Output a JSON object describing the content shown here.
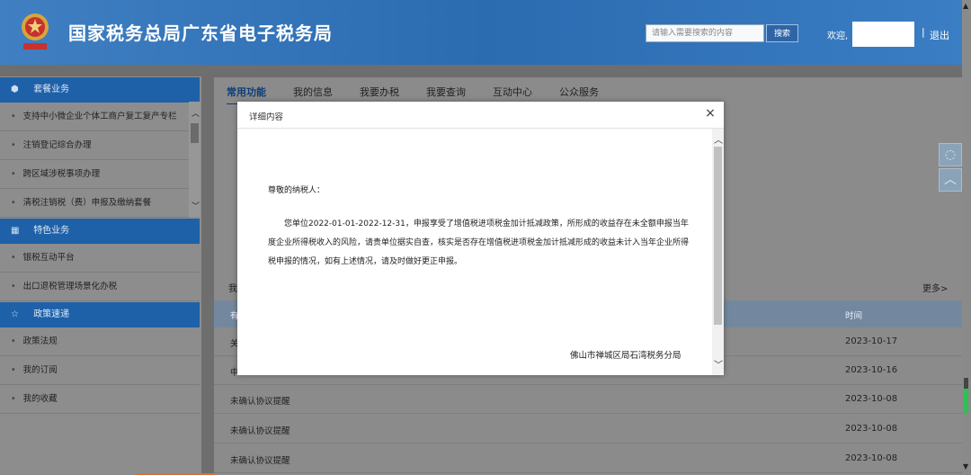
{
  "header": {
    "site_title": "国家税务总局广东省电子税务局",
    "search_placeholder": "请输入需要搜索的内容",
    "search_button": "搜索",
    "welcome": "欢迎,",
    "divider": "|",
    "logout": "退出"
  },
  "sidebar": {
    "sections": [
      {
        "title": "套餐业务",
        "icon": "cube-icon"
      },
      {
        "title": "特色业务",
        "icon": "grid-icon"
      },
      {
        "title": "政策速递",
        "icon": "star-icon"
      }
    ],
    "package_items": [
      "支持中小微企业个体工商户复工复产专栏",
      "注销登记综合办理",
      "跨区域涉税事项办理",
      "清税注销税（费）申报及缴纳套餐"
    ],
    "feature_items": [
      "银税互动平台",
      "出口退税管理场景化办税"
    ],
    "policy_items": [
      "政策法规",
      "我的订阅",
      "我的收藏"
    ]
  },
  "tabs": [
    {
      "label": "常用功能",
      "active": true
    },
    {
      "label": "我的信息",
      "active": false
    },
    {
      "label": "我要办税",
      "active": false
    },
    {
      "label": "我要查询",
      "active": false
    },
    {
      "label": "互动中心",
      "active": false
    },
    {
      "label": "公众服务",
      "active": false
    }
  ],
  "list": {
    "title_partial": "我",
    "more": "更多>",
    "header_title_partial": "有",
    "header_time": "时间",
    "rows": [
      {
        "title": "关",
        "date": "2023-10-17"
      },
      {
        "title": "中",
        "date": "2023-10-16"
      },
      {
        "title": "未确认协议提醒",
        "date": "2023-10-08"
      },
      {
        "title": "未确认协议提醒",
        "date": "2023-10-08"
      },
      {
        "title": "未确认协议提醒",
        "date": "2023-10-08"
      }
    ]
  },
  "modal": {
    "title": "详细内容",
    "close": "×",
    "greeting": "尊敬的纳税人：",
    "content": "您单位2022-01-01-2022-12-31，申报享受了增值税进项税金加计抵减政策，所形成的收益存在未全额申报当年度企业所得税收入的风险，请贵单位据实自查，核实是否存在增值税进项税金加计抵减形成的收益未计入当年企业所得税申报的情况，如有上述情况，请及时做好更正申报。",
    "signature": "佛山市禅城区局石湾税务分局"
  },
  "colors": {
    "header_blue": "#2b6bb0",
    "sidebar_section": "#1e61a8",
    "accent_green": "#2fbf55"
  }
}
